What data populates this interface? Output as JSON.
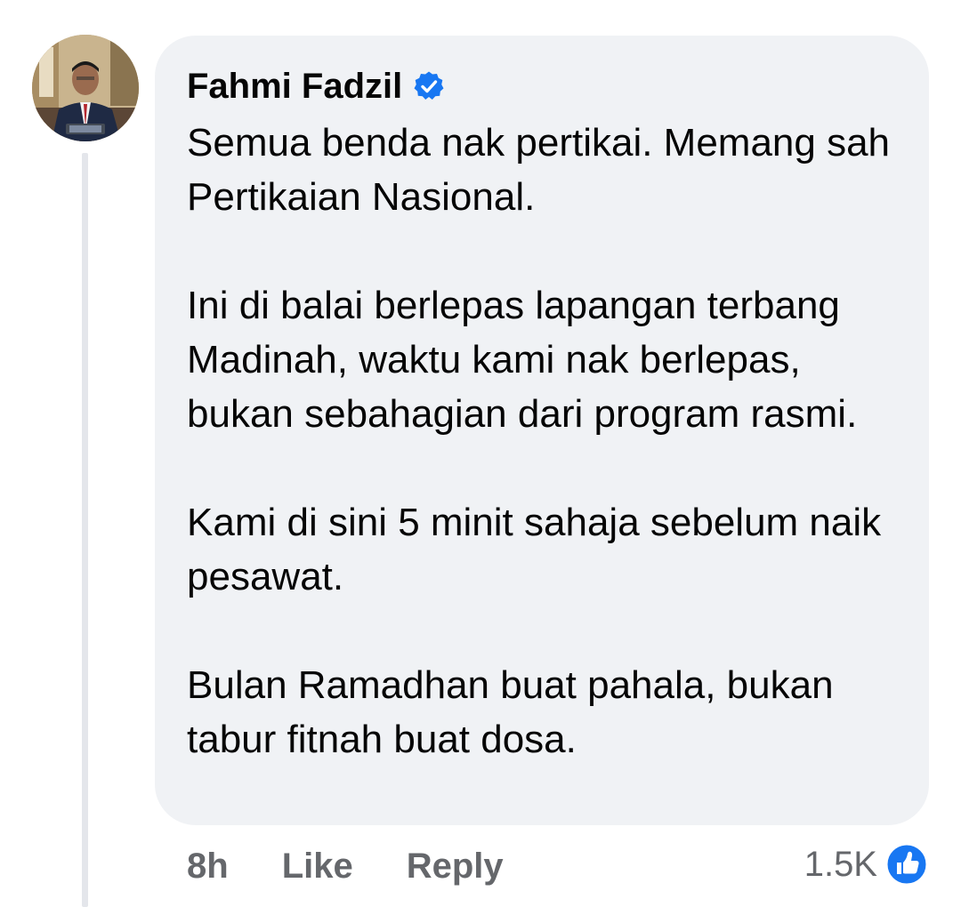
{
  "comment": {
    "author": "Fahmi Fadzil",
    "verified_icon": "verified-badge-icon",
    "avatar_icon": "profile-photo",
    "paragraphs": [
      "Semua benda nak pertikai. Memang sah Pertikaian Nasional.",
      "Ini di balai berlepas lapangan terbang Madinah, waktu kami nak berlepas, bukan sebahagian dari program rasmi.",
      "Kami di sini 5 minit sahaja sebelum naik pesawat.",
      "Bulan Ramadhan buat pahala, bukan tabur fitnah buat dosa."
    ]
  },
  "actions": {
    "timestamp": "8h",
    "like_label": "Like",
    "reply_label": "Reply"
  },
  "reactions": {
    "count": "1.5K",
    "icon": "like-reaction-icon"
  },
  "colors": {
    "bubble_background": "#f0f2f5",
    "secondary_text": "#65676b",
    "primary_text": "#050505",
    "accent_blue": "#1877f2",
    "thread_line": "#e4e6eb"
  }
}
